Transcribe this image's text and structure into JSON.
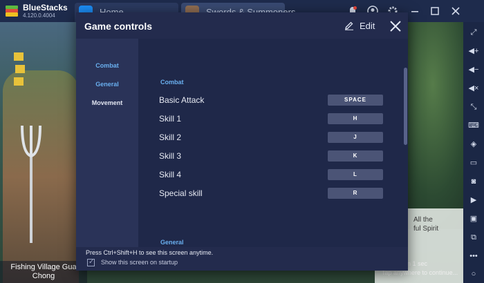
{
  "titlebar": {
    "app_name": "BlueStacks",
    "version": "4.120.0.4004",
    "tabs": [
      {
        "label": "Home",
        "icon": "home-icon"
      },
      {
        "label": "Swords & Summoners",
        "icon": "game-icon"
      }
    ],
    "controls": [
      "notification-bell-icon",
      "account-icon",
      "settings-gear-icon",
      "minimize-icon",
      "maximize-icon",
      "close-icon"
    ]
  },
  "game": {
    "character_label_line1": "Fishing Village Gua",
    "character_label_line2": "Chong",
    "quest_text_line1": "All the",
    "quest_text_line2": "ful Spirit",
    "auto_text_line1": "natically in 1 sec",
    "auto_text_line2": "Tap anywhere to continue..."
  },
  "modal": {
    "title": "Game controls",
    "edit_label": "Edit",
    "nav": [
      {
        "label": "Combat",
        "active": true
      },
      {
        "label": "General",
        "active": true
      },
      {
        "label": "Movement",
        "active": false
      }
    ],
    "sections": [
      {
        "heading": "Combat",
        "rows": [
          {
            "label": "Basic Attack",
            "key": "SPACE"
          },
          {
            "label": "Skill 1",
            "key": "H"
          },
          {
            "label": "Skill 2",
            "key": "J"
          },
          {
            "label": "Skill 3",
            "key": "K"
          },
          {
            "label": "Skill 4",
            "key": "L"
          },
          {
            "label": "Special skill",
            "key": "R"
          }
        ]
      },
      {
        "heading": "General",
        "rows": []
      }
    ],
    "footer_hint": "Press Ctrl+Shift+H to see this screen anytime.",
    "show_on_startup_label": "Show this screen on startup",
    "show_on_startup_checked": true
  },
  "sidebar_icons": [
    "fullscreen-icon",
    "volume-up-icon",
    "volume-down-icon",
    "mute-icon",
    "resize-icon",
    "keyboard-icon",
    "location-icon",
    "apk-install-icon",
    "screenshot-icon",
    "record-icon",
    "files-icon",
    "copy-icon",
    "more-icon",
    "back-icon",
    "home-circle-icon"
  ],
  "colors": {
    "accent": "#6ab0f0",
    "modal_bg": "#232b4d",
    "key_chip": "#4b5476"
  }
}
